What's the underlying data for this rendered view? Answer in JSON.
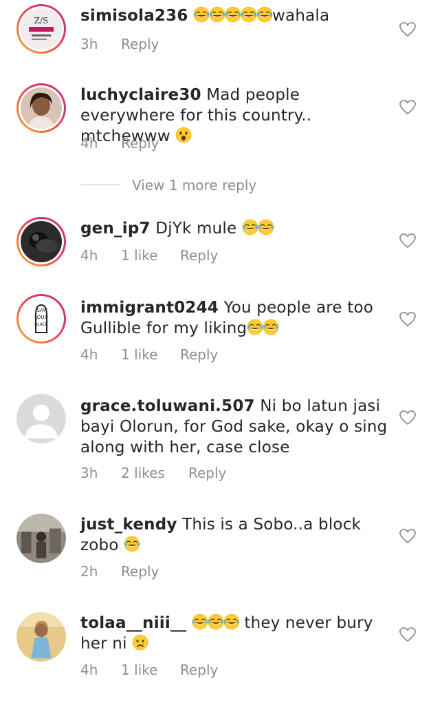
{
  "comments": [
    {
      "username": "simisola236",
      "text_before": " ",
      "emojis_before": 5,
      "emoji_kind_before": "joy",
      "text": "wahala",
      "time": "3h",
      "likes": "",
      "reply_label": "Reply",
      "avatar": "zs-logo-avatar",
      "story_ring": true
    },
    {
      "username": "luchyclaire30",
      "text": " Mad people everywhere for this country.. mtchewww ",
      "trailing_emoji": "astonished",
      "time": "4h",
      "likes": "",
      "reply_label": "Reply",
      "avatar": "woman-avatar",
      "story_ring": true
    },
    {
      "username": "gen_ip7",
      "text": " DjYk mule ",
      "trailing_emojis": 2,
      "time": "4h",
      "likes": "1 like",
      "reply_label": "Reply",
      "avatar": "dark-photo-avatar",
      "story_ring": true
    },
    {
      "username": "immigrant0244",
      "text": " You people are too Gullible for my liking",
      "trailing_emojis": 2,
      "time": "4h",
      "likes": "1 like",
      "reply_label": "Reply",
      "avatar": "say-it-loud-avatar",
      "story_ring": true
    },
    {
      "username": "grace.toluwani.507",
      "text": " Ni bo latun jasi bayi Olorun,  for God sake, okay o sing along with her, case close",
      "time": "3h",
      "likes": "2 likes",
      "reply_label": "Reply",
      "avatar": "default-avatar",
      "story_ring": false
    },
    {
      "username": "just_kendy",
      "text": " This is a Sobo..a block zobo ",
      "trailing_emojis": 1,
      "time": "2h",
      "likes": "",
      "reply_label": "Reply",
      "avatar": "room-photo-avatar",
      "story_ring": false
    },
    {
      "username": "tolaa__niii__",
      "text": "  they never bury her ni ",
      "time": "4h",
      "likes": "1 like",
      "reply_label": "Reply",
      "avatar": "girl-photo-avatar",
      "story_ring": false
    }
  ],
  "view_more_replies": "View 1 more reply",
  "icons": {
    "like": "heart-outline-icon",
    "joy": "face-with-tears-of-joy",
    "astonished": "astonished-face",
    "crying": "crying-face"
  },
  "colors": {
    "username": "#262626",
    "meta": "#8e8e8e",
    "ring_start": "#f7b733",
    "ring_end": "#c13584"
  }
}
